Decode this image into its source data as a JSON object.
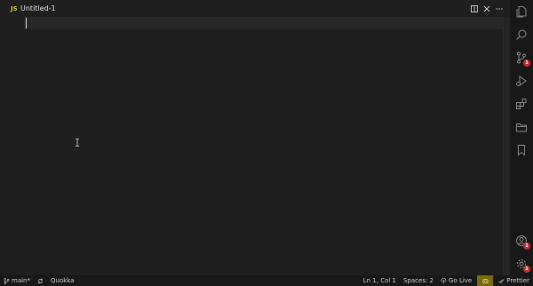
{
  "tab": {
    "language_icon": "JS",
    "title": "Untitled-1",
    "actions": [
      "split-editor-icon",
      "close-icon",
      "more-actions-icon"
    ]
  },
  "activity_bar": {
    "items": [
      {
        "name": "explorer",
        "icon": "files-icon"
      },
      {
        "name": "search",
        "icon": "search-icon"
      },
      {
        "name": "source-control",
        "icon": "source-control-icon",
        "badge": "1"
      },
      {
        "name": "run-and-debug",
        "icon": "run-debug-icon"
      },
      {
        "name": "extensions",
        "icon": "extensions-icon"
      },
      {
        "name": "remote-explorer",
        "icon": "folder-icon"
      },
      {
        "name": "bookmarks",
        "icon": "bookmark-icon"
      }
    ],
    "bottom": [
      {
        "name": "accounts",
        "icon": "account-icon",
        "badge": "1"
      },
      {
        "name": "manage",
        "icon": "gear-icon",
        "badge": "1"
      }
    ]
  },
  "status_bar": {
    "branch": "main*",
    "quokka": "Quokka",
    "position": "Ln 1, Col 1",
    "spaces": "Spaces: 2",
    "go_live": "Go Live",
    "prettier": "Prettier"
  },
  "colors": {
    "editor_bg": "#1f1f1f",
    "activity_bg": "#181818",
    "badge": "#c72e2e",
    "js_icon": "#cbcb41",
    "copilot_bg": "#7a6a00"
  }
}
